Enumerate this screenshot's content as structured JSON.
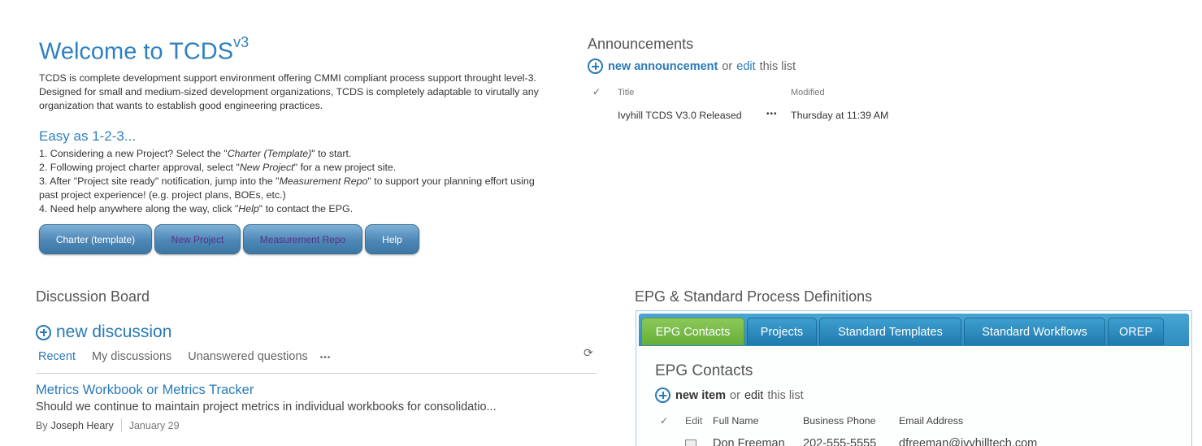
{
  "welcome": {
    "title": "Welcome to TCDS",
    "title_sup": "v3",
    "intro": "TCDS is complete development support environment offering CMMI compliant process support throught level-3. Designed for small and medium-sized development organizations, TCDS is completely adaptable to virutally any organization that wants to establish good engineering practices.",
    "easy_title": "Easy as 1-2-3...",
    "steps": [
      {
        "pre": "1. Considering a new Project? Select the \"",
        "em": "Charter (Template)",
        "post": "\" to start."
      },
      {
        "pre": "2. Following project charter approval, select \"",
        "em": "New Project",
        "post": "\" for a new project site."
      },
      {
        "pre": "3. After \"Project site ready\" notification, jump into the \"",
        "em": "Measurement Repo",
        "post": "\" to support your planning effort using"
      },
      {
        "pre": "past project experience! (e.g. project plans, BOEs, etc.)",
        "em": "",
        "post": ""
      },
      {
        "pre": "4. Need help anywhere along the way, click \"",
        "em": "Help",
        "post": "\" to contact the EPG."
      }
    ],
    "buttons": [
      "Charter (template)",
      "New Project",
      "Measurement Repo",
      "Help"
    ]
  },
  "announcements": {
    "title": "Announcements",
    "new_link": "new announcement",
    "or": "or",
    "edit": "edit",
    "this_list": "this list",
    "col_title": "Title",
    "col_modified": "Modified",
    "rows": [
      {
        "title": "Ivyhill TCDS V3.0 Released",
        "ellipsis": "•••",
        "modified": "Thursday at 11:39 AM"
      }
    ]
  },
  "discussion": {
    "title": "Discussion Board",
    "new_link": "new discussion",
    "tabs": [
      "Recent",
      "My discussions",
      "Unanswered questions"
    ],
    "more": "•••",
    "refresh_icon": "refresh-icon",
    "posts": [
      {
        "title": "Metrics Workbook or Metrics Tracker",
        "snippet": "Should we continue to maintain project metrics in individual workbooks for consolidatio...",
        "by": "By",
        "author": "Joseph Heary",
        "date": "January 29"
      }
    ]
  },
  "epg": {
    "title": "EPG & Standard Process Definitions",
    "tabs": [
      "EPG Contacts",
      "Projects",
      "Standard Templates",
      "Standard Workflows",
      "OREP"
    ],
    "active_tab": "EPG Contacts",
    "sub_title": "EPG Contacts",
    "new_link": "new item",
    "or": "or",
    "edit": "edit",
    "this_list": "this list",
    "columns": [
      "Edit",
      "Full Name",
      "Business Phone",
      "Email Address"
    ],
    "rows": [
      {
        "name": "Don Freeman",
        "phone": "202-555-5555",
        "email": "dfreeman@ivyhilltech.com"
      }
    ]
  },
  "colors": {
    "link_blue": "#2a7ab6",
    "tab_green": "#66ad38",
    "tab_blue": "#2e8cbf"
  }
}
